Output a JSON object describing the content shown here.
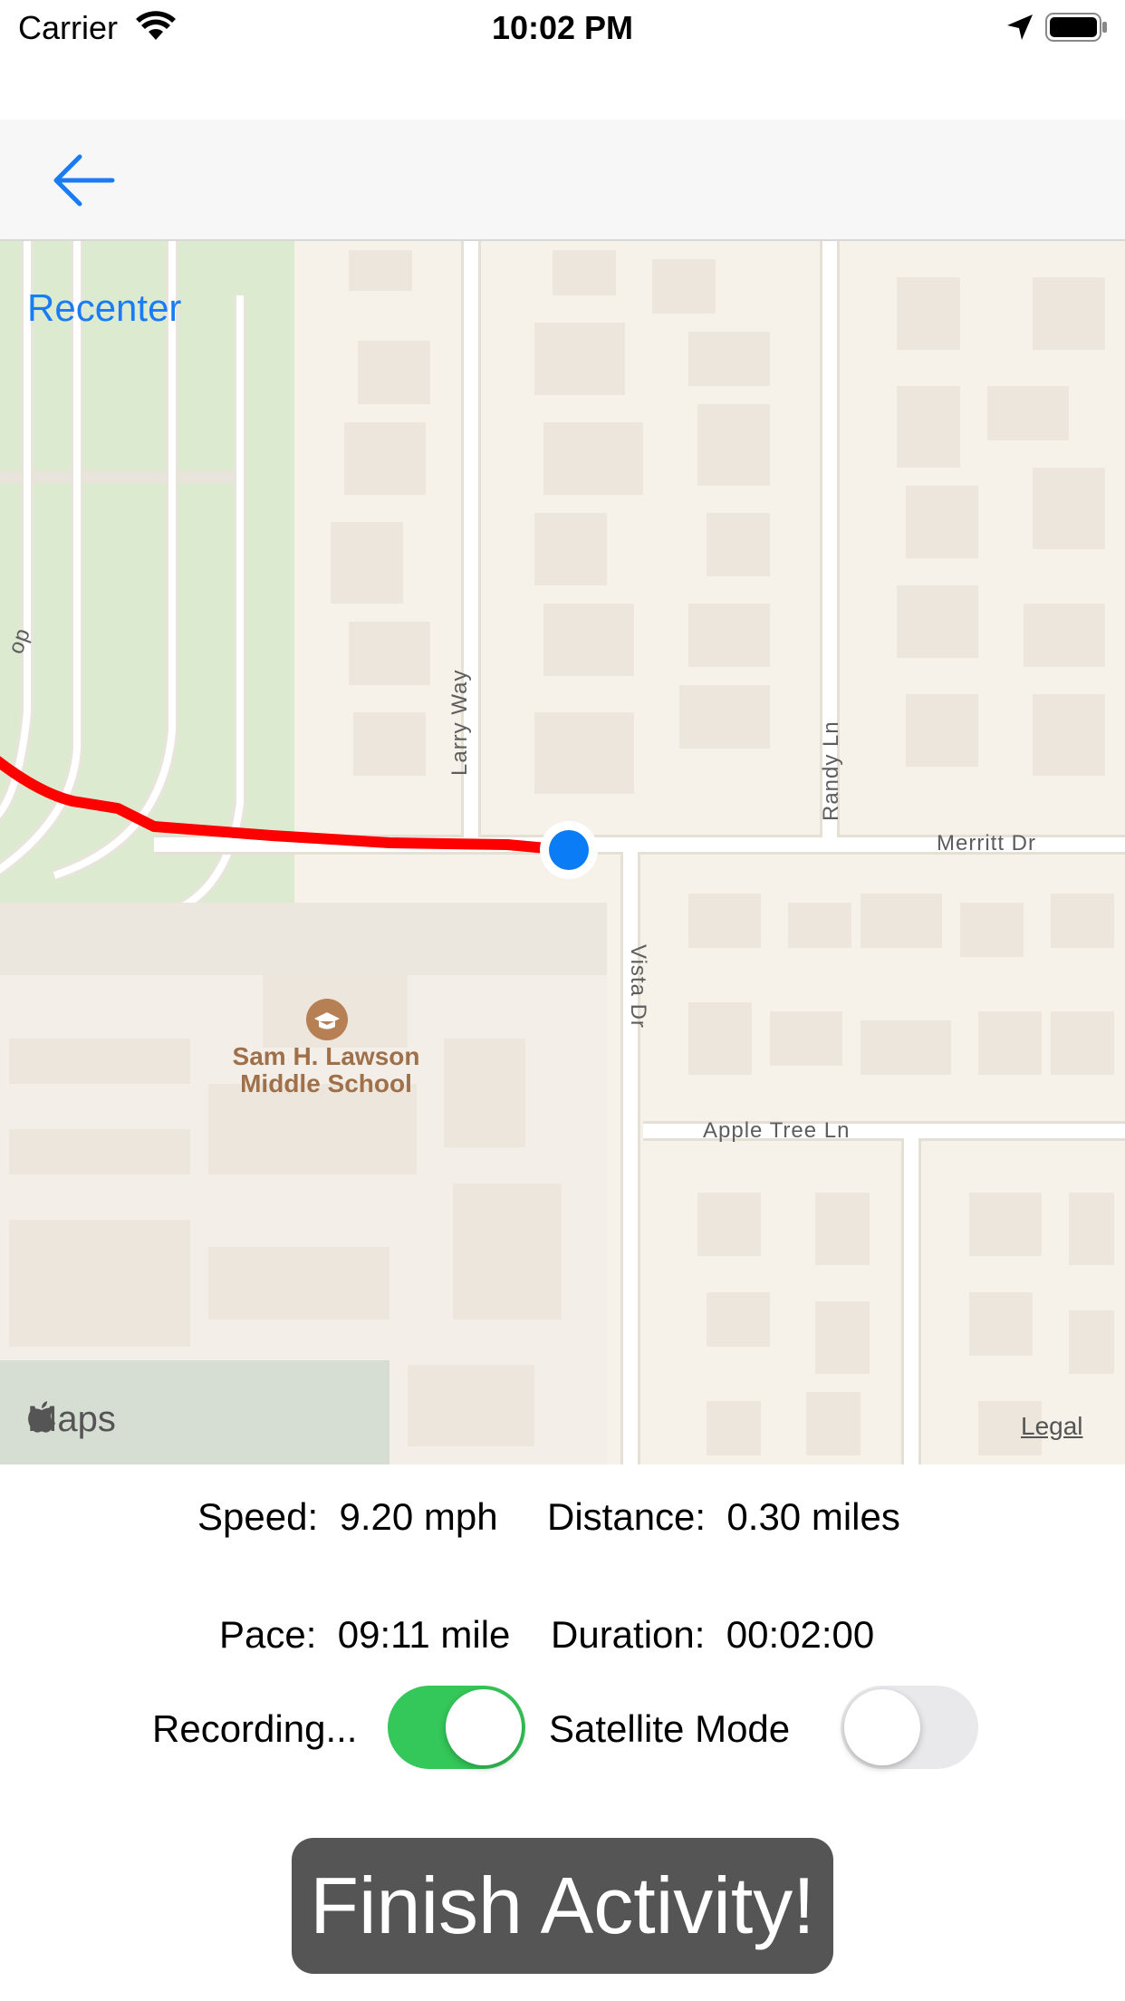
{
  "status_bar": {
    "carrier": "Carrier",
    "time": "10:02 PM"
  },
  "nav": {
    "back_icon": "arrow-left-icon"
  },
  "map": {
    "recenter_label": "Recenter",
    "streets": {
      "larry_way": "Larry Way",
      "randy_ln": "Randy Ln",
      "merritt_dr": "Merritt Dr",
      "vista_dr": "Vista Dr",
      "apple_tree_ln": "Apple Tree Ln",
      "loop_fragment": "op"
    },
    "poi": {
      "name_line1": "Sam H. Lawson",
      "name_line2": "Middle School"
    },
    "attribution": "Maps",
    "legal": "Legal",
    "route_color": "#ff0000",
    "location_color": "#0a7cf5"
  },
  "stats": {
    "speed_label": "Speed:",
    "speed_value": "9.20 mph",
    "distance_label": "Distance:",
    "distance_value": "0.30 miles",
    "pace_label": "Pace:",
    "pace_value": "09:11 mile",
    "duration_label": "Duration:",
    "duration_value": "00:02:00"
  },
  "toggles": {
    "recording_label": "Recording...",
    "recording_on": true,
    "satellite_label": "Satellite Mode",
    "satellite_on": false
  },
  "finish_button_label": "Finish Activity!"
}
